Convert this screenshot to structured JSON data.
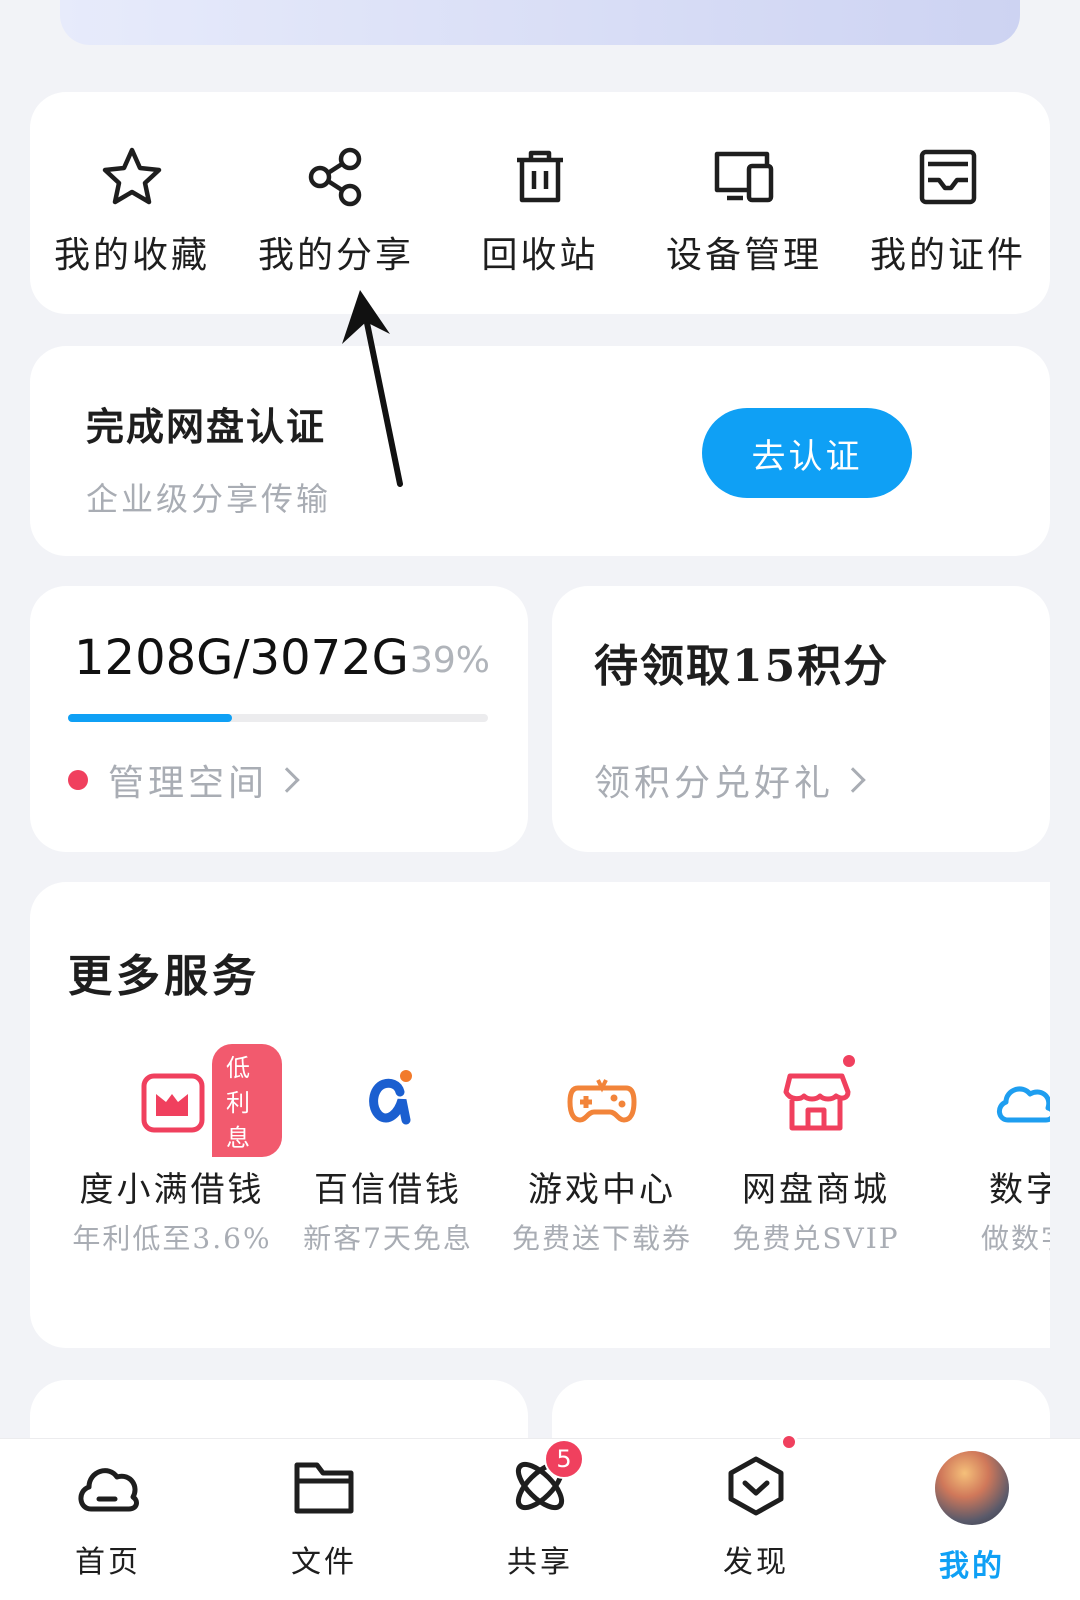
{
  "quick_actions": [
    {
      "label": "我的收藏",
      "icon": "star-icon"
    },
    {
      "label": "我的分享",
      "icon": "share-icon"
    },
    {
      "label": "回收站",
      "icon": "trash-icon"
    },
    {
      "label": "设备管理",
      "icon": "devices-icon"
    },
    {
      "label": "我的证件",
      "icon": "id-card-icon"
    }
  ],
  "certification": {
    "title": "完成网盘认证",
    "subtitle": "企业级分享传输",
    "button": "去认证"
  },
  "storage": {
    "value": "1208G/3072G",
    "percent_label": "39%",
    "used_fraction": 0.39,
    "link": "管理空间"
  },
  "points": {
    "title": "待领取15积分",
    "link": "领积分兑好礼"
  },
  "services": {
    "title": "更多服务",
    "items": [
      {
        "name": "度小满借钱",
        "desc": "年利低至3.6%",
        "badge": "低利息",
        "icon": "wallet-icon"
      },
      {
        "name": "百信借钱",
        "desc": "新客7天免息",
        "icon": "alpha-logo-icon"
      },
      {
        "name": "游戏中心",
        "desc": "免费送下载券",
        "icon": "gamepad-icon"
      },
      {
        "name": "网盘商城",
        "desc": "免费兑SVIP",
        "icon": "shop-icon"
      },
      {
        "name": "数字",
        "desc": "做数字",
        "icon": "cloud-icon"
      }
    ]
  },
  "tabs": [
    {
      "label": "首页",
      "icon": "cloud-home-icon"
    },
    {
      "label": "文件",
      "icon": "folder-icon"
    },
    {
      "label": "共享",
      "icon": "orbit-icon",
      "badge": "5"
    },
    {
      "label": "发现",
      "icon": "discover-icon"
    },
    {
      "label": "我的",
      "icon": "avatar",
      "active": true
    }
  ],
  "colors": {
    "accent": "#0fa0f5",
    "alert": "#f0405e",
    "muted_text": "#a9adb4",
    "background": "#f2f3f7"
  }
}
